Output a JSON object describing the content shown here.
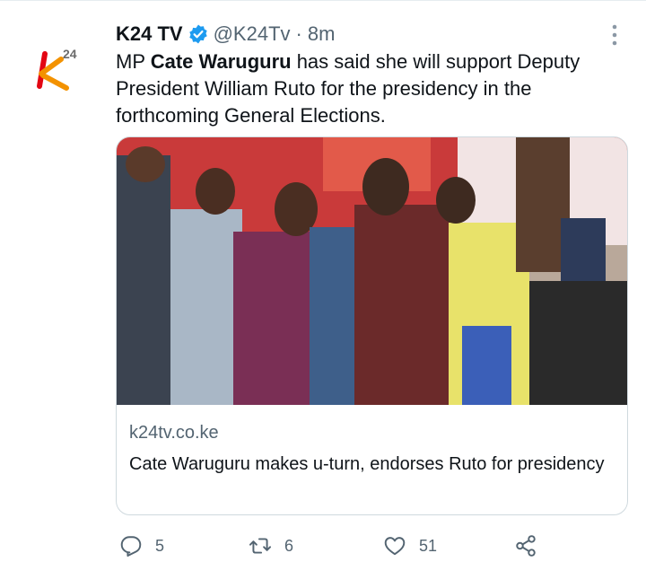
{
  "tweet": {
    "display_name": "K24 TV",
    "handle": "@K24Tv",
    "separator": "·",
    "time_ago": "8m",
    "text_before": "MP ",
    "text_bold": "Cate Waruguru",
    "text_after": " has said she will support Deputy President William Ruto for the presidency in the forthcoming General Elections."
  },
  "avatar": {
    "logo_text": "k",
    "logo_superscript": "24"
  },
  "card": {
    "domain": "k24tv.co.ke",
    "title": "Cate Waruguru makes u-turn, endorses Ruto for presidency"
  },
  "actions": {
    "reply_count": "5",
    "retweet_count": "6",
    "like_count": "51"
  },
  "icons": {
    "avatar": "k24-logo-icon",
    "verified": "verified-badge-icon",
    "more": "more-vertical-icon",
    "reply": "reply-icon",
    "retweet": "retweet-icon",
    "like": "heart-icon",
    "share": "share-icon"
  },
  "colors": {
    "text": "#0f1419",
    "secondary": "#536471",
    "verified": "#1d9bf0",
    "logo_orange": "#f39200",
    "logo_red": "#e30613"
  }
}
